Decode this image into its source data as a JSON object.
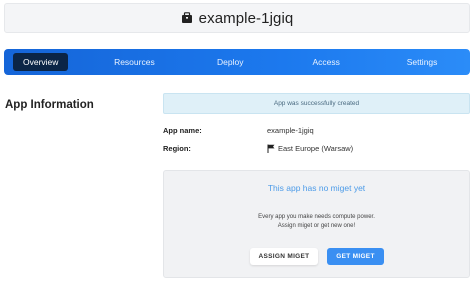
{
  "header": {
    "title": "example-1jgiq",
    "icon": "box-icon"
  },
  "tabs": [
    {
      "label": "Overview",
      "active": true
    },
    {
      "label": "Resources",
      "active": false
    },
    {
      "label": "Deploy",
      "active": false
    },
    {
      "label": "Access",
      "active": false
    },
    {
      "label": "Settings",
      "active": false
    }
  ],
  "section": {
    "title": "App Information"
  },
  "alert": {
    "text": "App was successfully created"
  },
  "app_info": {
    "name_label": "App name:",
    "name_value": "example-1jgiq",
    "region_label": "Region:",
    "region_value": "East Europe (Warsaw)",
    "region_icon": "flag-icon"
  },
  "miget_panel": {
    "title": "This app has no miget yet",
    "desc_line1": "Every app you make needs compute power.",
    "desc_line2": "Assign miget or get new one!",
    "assign_button": "ASSIGN MIGET",
    "get_button": "GET MIGET"
  },
  "colors": {
    "tab_gradient_start": "#1565d8",
    "tab_gradient_end": "#2b8cf8",
    "active_tab": "#0b2546",
    "primary_button": "#3a8ff2",
    "alert_bg": "#dff0f8"
  }
}
